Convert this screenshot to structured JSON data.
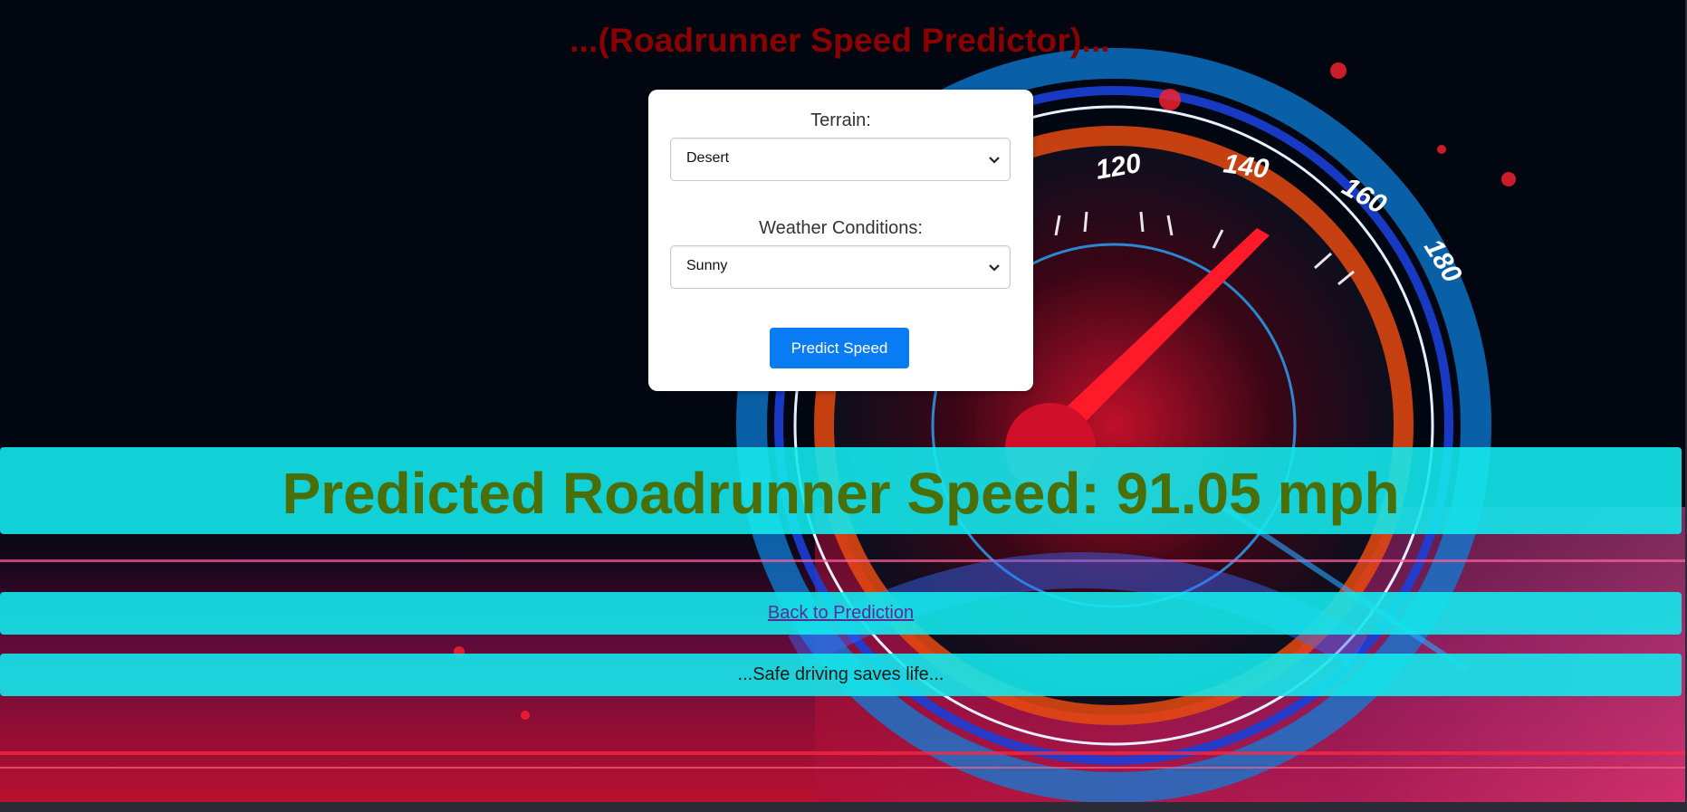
{
  "header": {
    "title": "...(Roadrunner Speed Predictor)..."
  },
  "form": {
    "terrain_label": "Terrain:",
    "terrain_value": "Desert",
    "weather_label": "Weather Conditions:",
    "weather_value": "Sunny",
    "predict_button": "Predict Speed"
  },
  "result": {
    "text": "Predicted Roadrunner Speed: 91.05 mph"
  },
  "nav": {
    "back_link": "Back to Prediction"
  },
  "footer": {
    "text": "...Safe driving saves life..."
  },
  "background": {
    "description_icon": "speedometer-background",
    "gauge_labels": [
      "120",
      "140",
      "160",
      "180"
    ]
  },
  "colors": {
    "title": "#8b0000",
    "band": "#14e8ec",
    "result_text": "#4a6e0a",
    "button": "#0a7cf3"
  }
}
